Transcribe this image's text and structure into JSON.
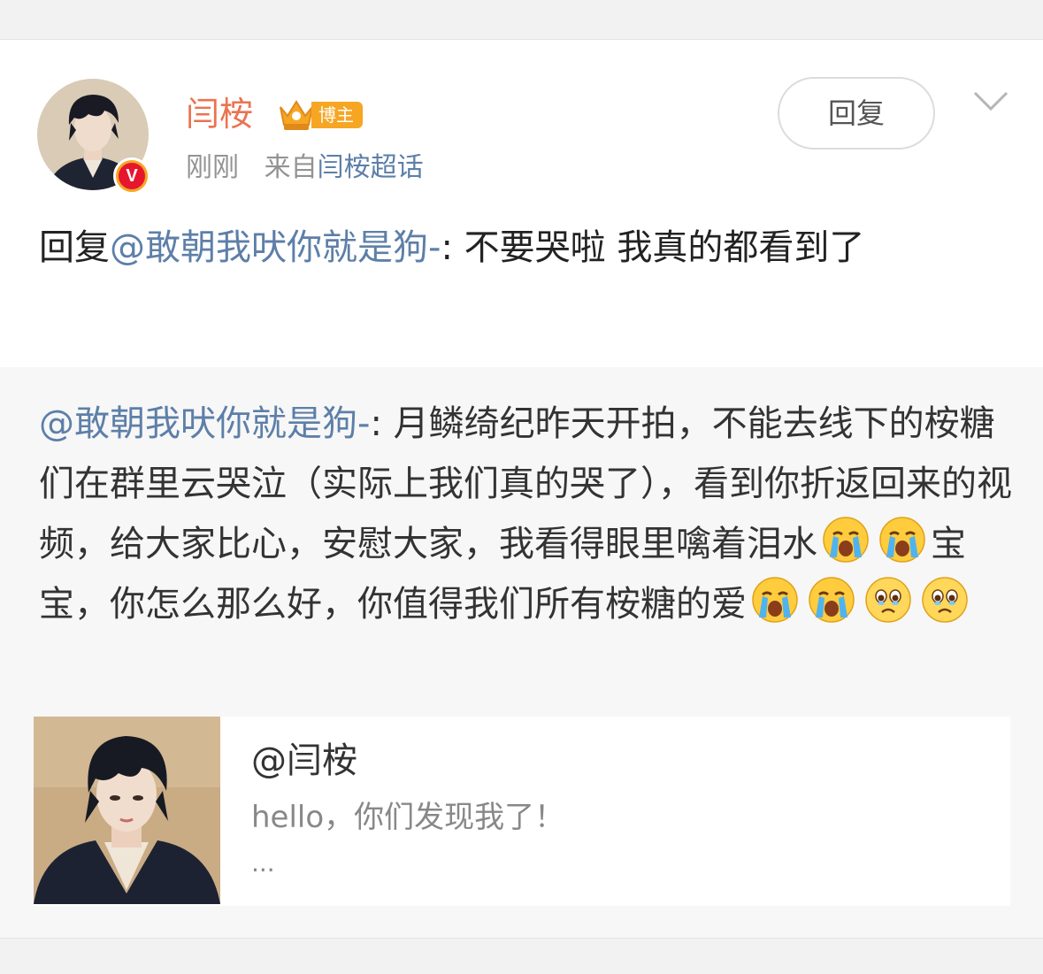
{
  "post": {
    "author": {
      "name": "闫桉",
      "badge_label": "博主",
      "verified_mark": "V"
    },
    "meta": {
      "time": "刚刚",
      "source_prefix": "来自",
      "source_name": "闫桉超话"
    },
    "reply_button": "回复",
    "menu_icon": "chevron-down-icon",
    "reply": {
      "prefix": "回复",
      "mention": "@敢朝我吠你就是狗-",
      "text": ": 不要哭啦 我真的都看到了"
    }
  },
  "quoted": {
    "mention": "@敢朝我吠你就是狗-",
    "text_1": ": 月鳞绮纪昨天开拍，不能去线下的桉糖们在群里云哭泣（实际上我们真的哭了），看到你折返回来的视频，给大家比心，安慰大家，我看得眼里噙着泪水",
    "text_2": "宝宝，你怎么那么好，你值得我们所有桉糖的爱",
    "emojis_after_text_1": [
      "crying-emoji",
      "crying-emoji"
    ],
    "emojis_after_text_2": [
      "crying-emoji",
      "crying-emoji",
      "teary-eyed-emoji",
      "teary-eyed-emoji"
    ]
  },
  "card": {
    "title": "@闫桉",
    "description": "hello，你们发现我了！",
    "ellipsis": "..."
  },
  "colors": {
    "username": "#eb7350",
    "link": "#5d7fa8",
    "badge": "#f6a623",
    "verified": "#e6162d"
  }
}
